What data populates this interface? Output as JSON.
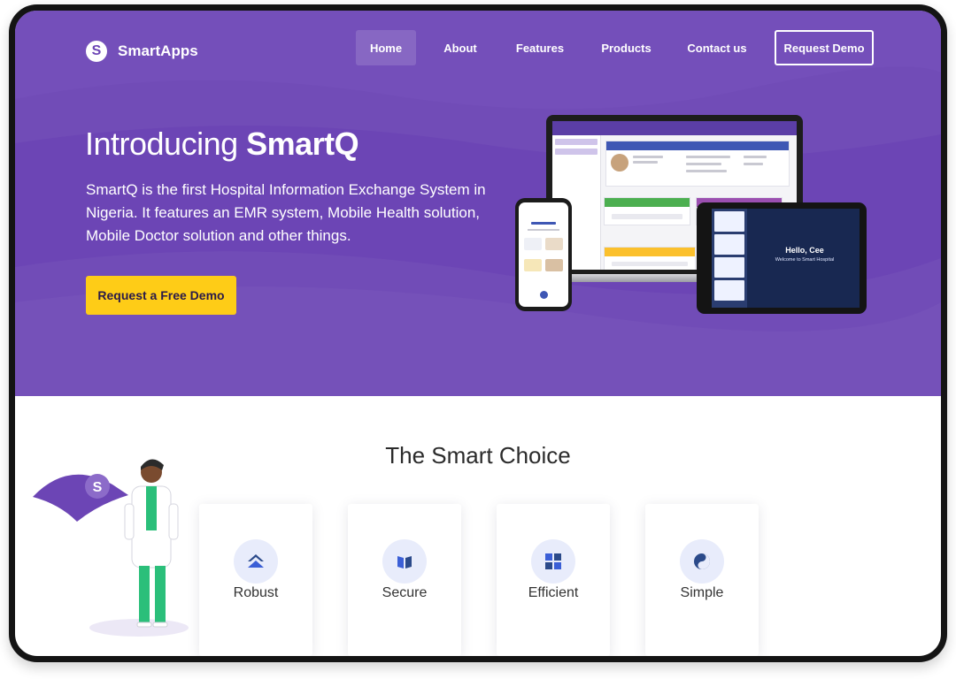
{
  "brand": {
    "logo_letter": "S",
    "name": "SmartApps"
  },
  "nav": {
    "items": [
      "Home",
      "About",
      "Features",
      "Products",
      "Contact us"
    ],
    "active": "Home",
    "cta": "Request Demo"
  },
  "hero": {
    "title_prefix": "Introducing ",
    "title_strong": "SmartQ",
    "description": "SmartQ is the first Hospital Information Exchange System in Nigeria. It features an EMR system, Mobile Health solution, Mobile Doctor solution and other things.",
    "cta": "Request a Free Demo"
  },
  "devices": {
    "tablet_greeting": "Hello, Cee",
    "tablet_subtitle": "Welcome to Smart Hospital"
  },
  "features_section": {
    "title": "The Smart Choice",
    "cards": [
      {
        "label": "Robust",
        "icon": "chevron-up-stack-icon"
      },
      {
        "label": "Secure",
        "icon": "book-icon"
      },
      {
        "label": "Efficient",
        "icon": "grid-icon"
      },
      {
        "label": "Simple",
        "icon": "swirl-icon"
      }
    ]
  },
  "colors": {
    "primary": "#6c45b5",
    "cta": "#fecc17",
    "icon_bg": "#e8ecfb",
    "icon_fg": "#3b5fd6",
    "dark_teal": "#2b4a8a"
  }
}
